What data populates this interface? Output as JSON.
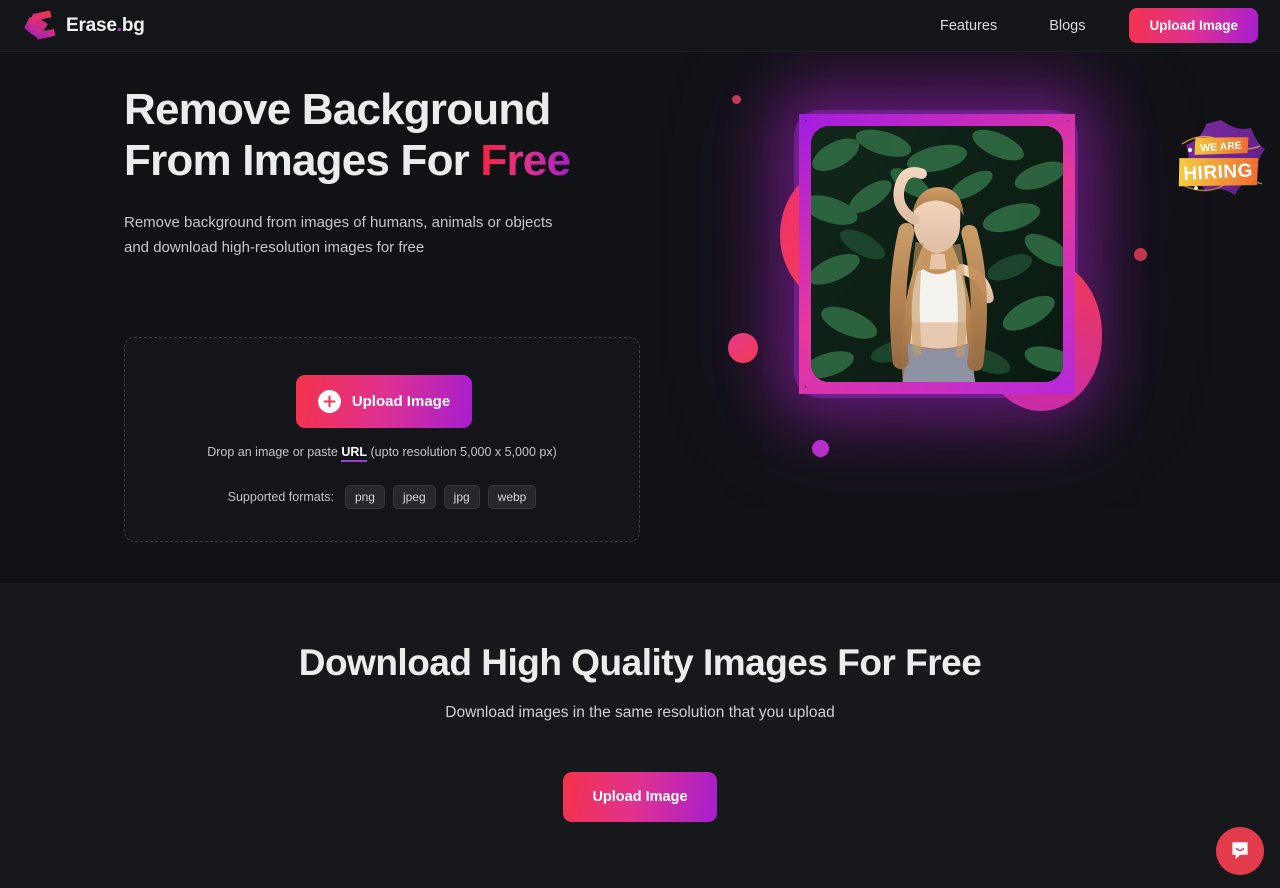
{
  "header": {
    "brand": {
      "name": "Erase",
      "dot": ".",
      "suffix": "bg",
      "logo_icon": "erase-bg-diamond-logo"
    },
    "nav": [
      {
        "label": "Features",
        "name": "nav-link-features"
      },
      {
        "label": "Blogs",
        "name": "nav-link-blogs"
      }
    ],
    "cta_label": "Upload Image"
  },
  "hero": {
    "title_line1": "Remove Background",
    "title_line2_plain": "From Images For ",
    "title_line2_accent": "Free",
    "subtitle_line1": "Remove background from images of humans, animals or objects",
    "subtitle_line2": "and download high-resolution images for free",
    "dropzone": {
      "upload_button_label": "Upload Image",
      "plus_icon": "plus-circle-icon",
      "hint_prefix": "Drop an image or paste ",
      "hint_link": "URL",
      "hint_suffix": " (upto resolution 5,000 x 5,000 px)",
      "formats_label": "Supported formats:",
      "formats": [
        "png",
        "jpeg",
        "jpg",
        "webp"
      ]
    },
    "artwork": {
      "photo_alt": "woman-with-long-curly-hair-in-front-of-green-leaves",
      "hiring_badge": {
        "line1": "WE ARE",
        "line2": "HIRING"
      }
    }
  },
  "download_section": {
    "title": "Download High Quality Images For Free",
    "subtitle": "Download images in the same resolution that you upload",
    "cta_label": "Upload Image"
  },
  "chat": {
    "icon": "chat-bubble-smile-icon"
  },
  "colors": {
    "page_bg": "#111216",
    "header_bg": "#141518",
    "section_bg": "#17181b",
    "accent_red": "#f5334a",
    "accent_pink": "#e0318f",
    "accent_purple": "#a61ed0",
    "chat_red": "#e13b4c",
    "url_underline": "#9b3fd4"
  }
}
